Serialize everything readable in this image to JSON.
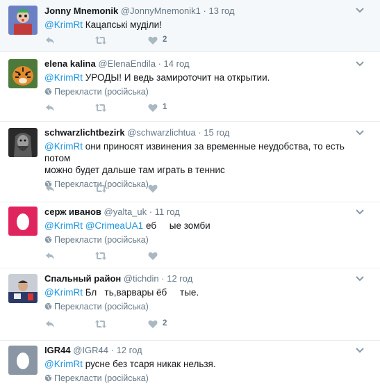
{
  "tweets": [
    {
      "name": "Jonny Mnemonik",
      "handle": "@JonnyMnemonik1",
      "time": "13 год",
      "mentions": [
        "@KrimRt"
      ],
      "text": "Кацапські муділи!",
      "translate": "",
      "likes": "2"
    },
    {
      "name": "elena kalina",
      "handle": "@ElenaEndila",
      "time": "14 год",
      "mentions": [
        "@KrimRt"
      ],
      "text": "УРОДЫ! И ведь замироточит на открытии.",
      "translate": "Перекласти (російська)",
      "likes": "1"
    },
    {
      "name": "schwarzlichtbezirk",
      "handle": "@schwarzlichtua",
      "time": "15 год",
      "mentions": [
        "@KrimRt"
      ],
      "text": "они приносят извинения за временные неудобства, то есть потом",
      "text2": "можно будет дальше там играть в теннис",
      "translate": "Перекласти (російська)",
      "likes": ""
    },
    {
      "name": "серж иванов",
      "handle": "@yalta_uk",
      "time": "11 год",
      "mentions": [
        "@KrimRt",
        "@CrimeaUA1"
      ],
      "text": "еб     ые зомби",
      "translate": "Перекласти (російська)",
      "likes": ""
    },
    {
      "name": "Спальный район",
      "handle": "@tichdin",
      "time": "12 год",
      "mentions": [
        "@KrimRt"
      ],
      "text": "Бл   ть,варвары ёб     тые.",
      "translate": "Перекласти (російська)",
      "likes": "2"
    },
    {
      "name": "IGR44",
      "handle": "@IGR44",
      "time": "12 год",
      "mentions": [
        "@KrimRt"
      ],
      "text": "русне без тсаря никак нельзя.",
      "translate": "Перекласти (російська)",
      "likes": ""
    }
  ],
  "separator": "·",
  "icons": [
    "reply-icon",
    "retweet-icon",
    "like-icon",
    "chevron-down-icon",
    "globe-icon"
  ]
}
